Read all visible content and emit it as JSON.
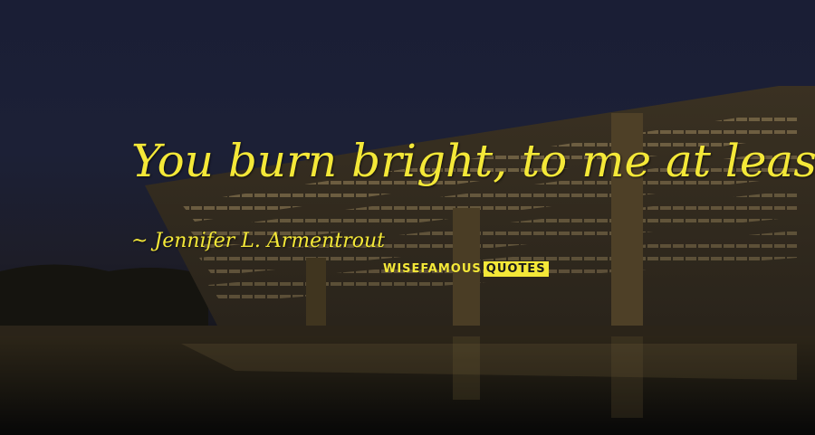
{
  "quote": {
    "text": "You burn bright, to me at least,",
    "author": "~ Jennifer L. Armentrout"
  },
  "watermark": {
    "part_a": "WISEFAMOUS",
    "part_b": "QUOTES",
    "color": "#f4e838"
  },
  "colors": {
    "text_accent": "#f4e838",
    "sky": "#1b1f33"
  }
}
